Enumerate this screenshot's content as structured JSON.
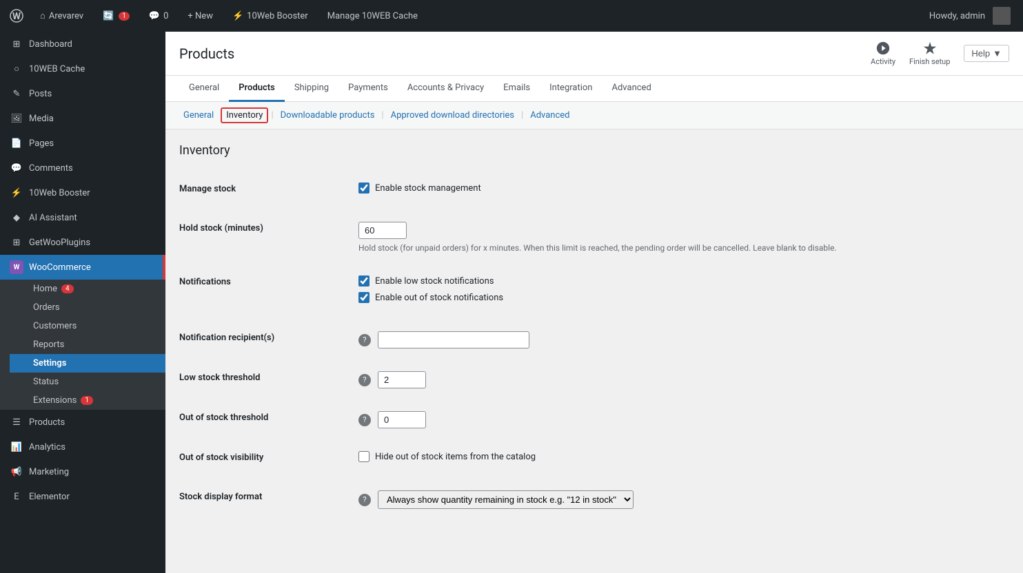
{
  "adminBar": {
    "site": "Arevarev",
    "updates": "1",
    "comments": "0",
    "new_label": "+ New",
    "booster": "10Web Booster",
    "cache": "Manage 10WEB Cache",
    "howdy": "Howdy, admin"
  },
  "sidebar": {
    "dashboard_label": "Dashboard",
    "tenweb_label": "10WEB Cache",
    "posts_label": "Posts",
    "media_label": "Media",
    "pages_label": "Pages",
    "comments_label": "Comments",
    "booster_label": "10Web Booster",
    "ai_label": "AI Assistant",
    "getwoo_label": "GetWooPlugins",
    "woocommerce_label": "WooCommerce",
    "home_label": "Home",
    "home_badge": "4",
    "orders_label": "Orders",
    "customers_label": "Customers",
    "reports_label": "Reports",
    "settings_label": "Settings",
    "status_label": "Status",
    "extensions_label": "Extensions",
    "extensions_badge": "1",
    "products_label": "Products",
    "analytics_label": "Analytics",
    "marketing_label": "Marketing",
    "elementor_label": "Elementor"
  },
  "contentTopbar": {
    "title": "Products",
    "activity_label": "Activity",
    "finish_setup_label": "Finish setup",
    "help_label": "Help"
  },
  "tabs": [
    {
      "id": "general",
      "label": "General"
    },
    {
      "id": "products",
      "label": "Products",
      "active": true
    },
    {
      "id": "shipping",
      "label": "Shipping"
    },
    {
      "id": "payments",
      "label": "Payments"
    },
    {
      "id": "accounts",
      "label": "Accounts & Privacy"
    },
    {
      "id": "emails",
      "label": "Emails"
    },
    {
      "id": "integration",
      "label": "Integration"
    },
    {
      "id": "advanced",
      "label": "Advanced"
    }
  ],
  "subNav": [
    {
      "id": "general",
      "label": "General"
    },
    {
      "id": "inventory",
      "label": "Inventory",
      "active": true
    },
    {
      "id": "downloadable",
      "label": "Downloadable products"
    },
    {
      "id": "approved",
      "label": "Approved download directories"
    },
    {
      "id": "advanced",
      "label": "Advanced"
    }
  ],
  "inventory": {
    "section_title": "Inventory",
    "manage_stock_label": "Manage stock",
    "manage_stock_checkbox": "Enable stock management",
    "hold_stock_label": "Hold stock (minutes)",
    "hold_stock_value": "60",
    "hold_stock_description": "Hold stock (for unpaid orders) for x minutes. When this limit is reached, the pending order will be cancelled. Leave blank to disable.",
    "notifications_label": "Notifications",
    "low_stock_notification": "Enable low stock notifications",
    "out_of_stock_notification": "Enable out of stock notifications",
    "notification_recipients_label": "Notification recipient(s)",
    "notification_recipients_value": "",
    "low_stock_threshold_label": "Low stock threshold",
    "low_stock_threshold_value": "2",
    "out_of_stock_threshold_label": "Out of stock threshold",
    "out_of_stock_threshold_value": "0",
    "out_of_stock_visibility_label": "Out of stock visibility",
    "out_of_stock_visibility_checkbox": "Hide out of stock items from the catalog",
    "stock_display_format_label": "Stock display format"
  }
}
